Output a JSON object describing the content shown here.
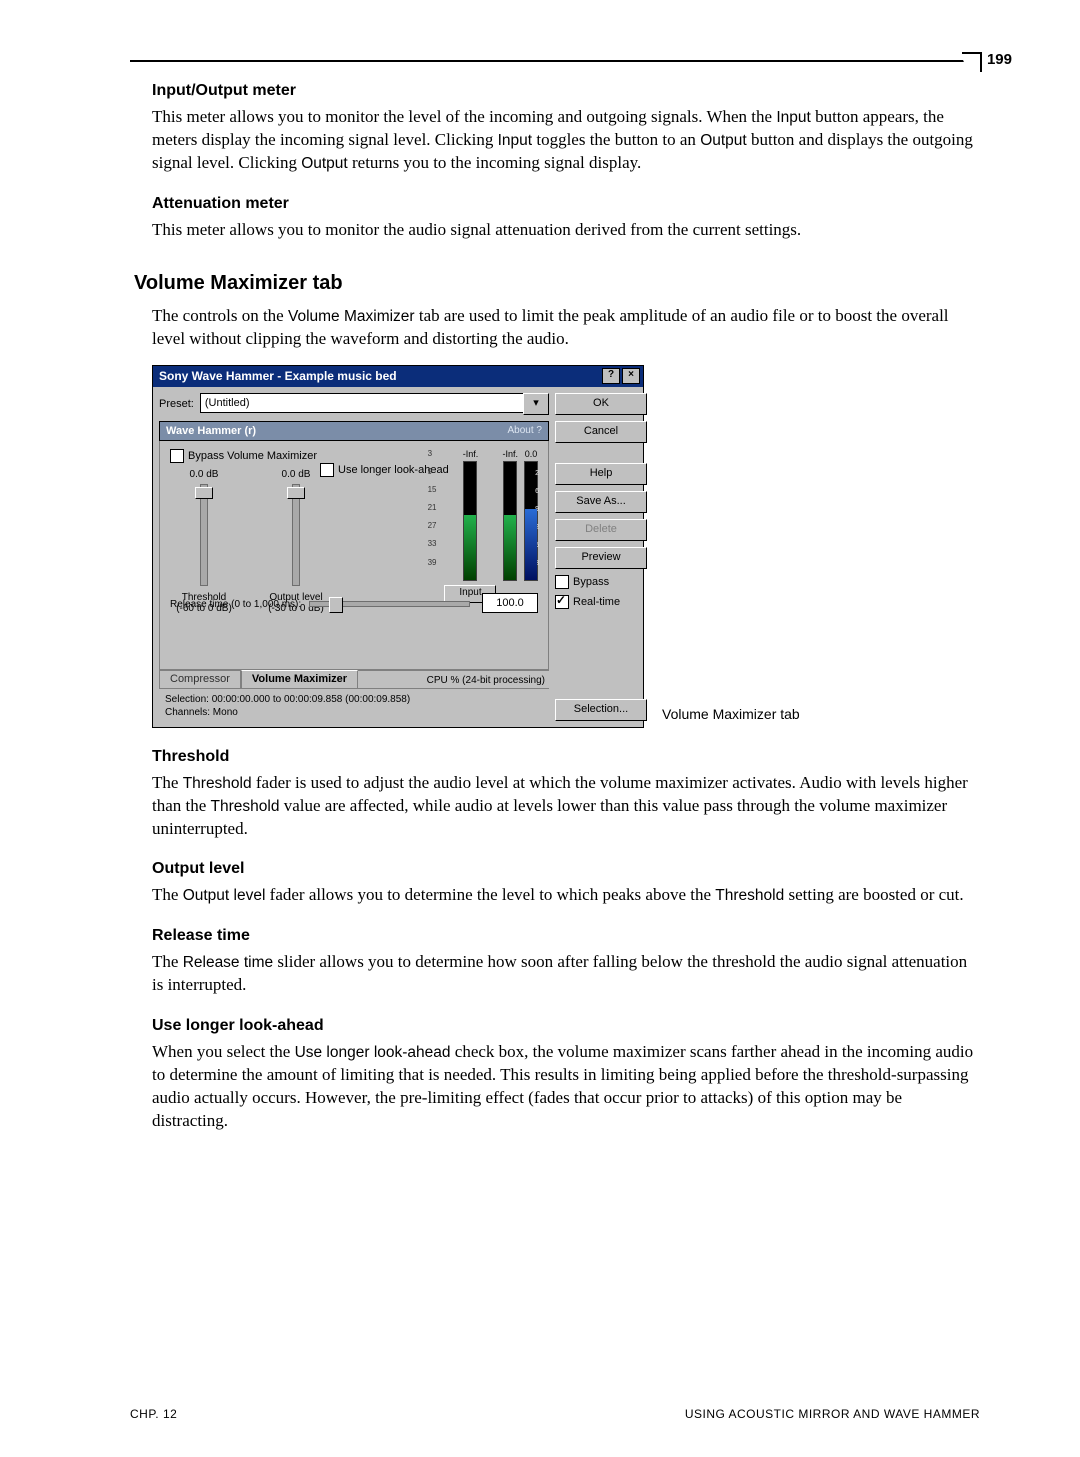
{
  "page_number": "199",
  "footer": {
    "left": "CHP. 12",
    "right": "USING ACOUSTIC MIRROR AND WAVE HAMMER"
  },
  "sec1": {
    "h": "Input/Output meter",
    "p_a": "This meter allows you to monitor the level of the incoming and outgoing signals. When the ",
    "p_b": " button appears, the meters display the incoming signal level. Clicking ",
    "p_c": " toggles the button to an ",
    "p_d": " button and displays the outgoing signal level. Clicking ",
    "p_e": " returns you to the incoming signal display.",
    "t_input": "Input",
    "t_output": "Output"
  },
  "sec2": {
    "h": "Attenuation meter",
    "p": "This meter allows you to monitor the audio signal attenuation derived from the current settings."
  },
  "sec3": {
    "h": "Volume Maximizer tab",
    "p_a": "The controls on the ",
    "p_b": " tab are used to limit the peak amplitude of an audio file or to boost the overall level without clipping the waveform and distorting the audio.",
    "t_vm": "Volume Maximizer"
  },
  "sec_threshold": {
    "h": "Threshold",
    "p_a": "The ",
    "p_b": " fader is used to adjust the audio level at which the volume maximizer activates. Audio with levels higher than the ",
    "p_c": " value are affected, while audio at levels lower than this value pass through the volume maximizer uninterrupted.",
    "t": "Threshold"
  },
  "sec_output": {
    "h": "Output level",
    "p_a": "The ",
    "p_b": " fader allows you to determine the level to which peaks above the ",
    "p_c": " setting are boosted or cut.",
    "t_ol": "Output level",
    "t_th": "Threshold"
  },
  "sec_release": {
    "h": "Release time",
    "p_a": "The ",
    "p_b": " slider allows you to determine how soon after falling below the threshold the audio signal attenuation is interrupted.",
    "t": "Release time"
  },
  "sec_look": {
    "h": "Use longer look-ahead",
    "p_a": "When you select the ",
    "p_b": " check box, the volume maximizer scans farther ahead in the incoming audio to determine the amount of limiting that is needed. This results in limiting being applied before the threshold-surpassing audio actually occurs. However, the pre-limiting effect (fades that occur prior to attacks) of this option may be distracting.",
    "t": "Use longer look-ahead"
  },
  "caption": "Volume Maximizer tab",
  "dlg": {
    "title": "Sony Wave Hammer - Example music bed",
    "help_glyph": "?",
    "close_glyph": "×",
    "preset_label": "Preset:",
    "preset_value": "(Untitled)",
    "tab_header": "Wave Hammer (r)",
    "about": "About  ?",
    "bypass_vm": "Bypass Volume Maximizer",
    "lookahead": "Use longer look-ahead",
    "threshold_val": "0.0 dB",
    "output_val": "0.0 dB",
    "threshold_lbl": "Threshold\n(-60 to 0 dB)",
    "output_lbl": "Output level\n(-30 to 0 dB)",
    "release_lbl": "Release time (0 to 1,000 ms):",
    "release_val": "100.0",
    "meter_in_top": "-Inf.",
    "meter_out_top": "-Inf.",
    "meter_atten_top": "0.0",
    "meter_ticks": [
      "3",
      "9",
      "15",
      "21",
      "27",
      "33",
      "39"
    ],
    "meter_atten_ticks": [
      "2",
      "6",
      "9",
      "12",
      "15",
      "18",
      "21"
    ],
    "input_btn": "Input",
    "tab_compressor": "Compressor",
    "tab_vm": "Volume Maximizer",
    "cpu": "CPU %  (24-bit processing)",
    "sel_line1": "Selection:   00:00:00.000 to 00:00:09.858 (00:00:09.858)",
    "sel_line2": "Channels:  Mono",
    "right": {
      "ok": "OK",
      "cancel": "Cancel",
      "help": "Help",
      "saveas": "Save As...",
      "delete": "Delete",
      "preview": "Preview",
      "bypass": "Bypass",
      "realtime": "Real-time",
      "selection": "Selection..."
    }
  }
}
